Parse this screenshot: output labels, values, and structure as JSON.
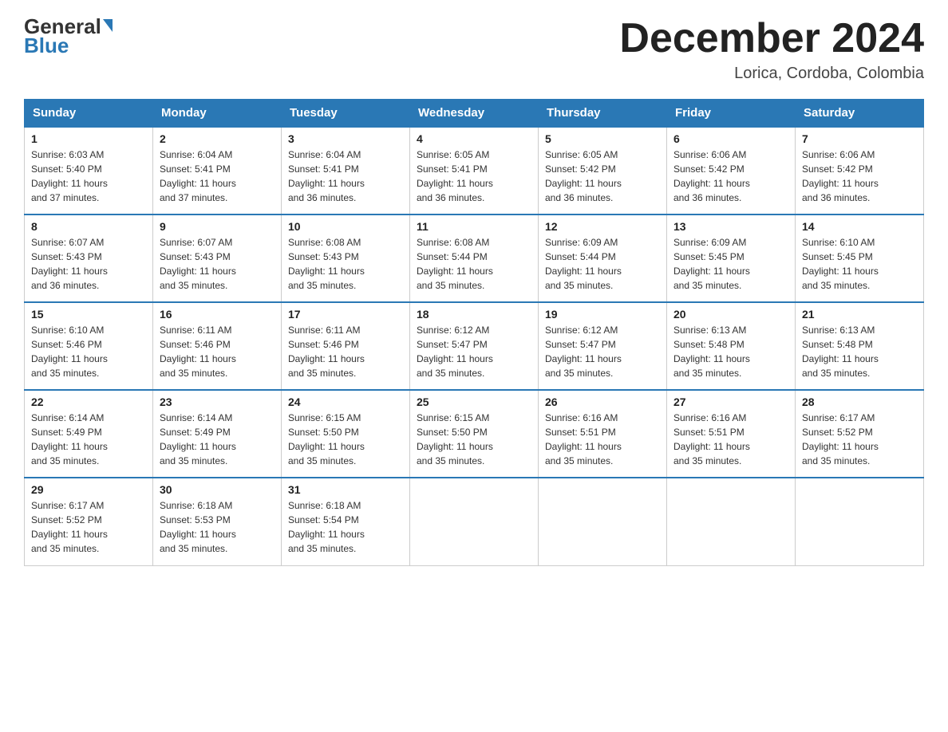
{
  "header": {
    "logo_general": "General",
    "logo_blue": "Blue",
    "title": "December 2024",
    "subtitle": "Lorica, Cordoba, Colombia"
  },
  "days_of_week": [
    "Sunday",
    "Monday",
    "Tuesday",
    "Wednesday",
    "Thursday",
    "Friday",
    "Saturday"
  ],
  "weeks": [
    [
      {
        "day": "1",
        "sunrise": "6:03 AM",
        "sunset": "5:40 PM",
        "daylight": "11 hours and 37 minutes."
      },
      {
        "day": "2",
        "sunrise": "6:04 AM",
        "sunset": "5:41 PM",
        "daylight": "11 hours and 37 minutes."
      },
      {
        "day": "3",
        "sunrise": "6:04 AM",
        "sunset": "5:41 PM",
        "daylight": "11 hours and 36 minutes."
      },
      {
        "day": "4",
        "sunrise": "6:05 AM",
        "sunset": "5:41 PM",
        "daylight": "11 hours and 36 minutes."
      },
      {
        "day": "5",
        "sunrise": "6:05 AM",
        "sunset": "5:42 PM",
        "daylight": "11 hours and 36 minutes."
      },
      {
        "day": "6",
        "sunrise": "6:06 AM",
        "sunset": "5:42 PM",
        "daylight": "11 hours and 36 minutes."
      },
      {
        "day": "7",
        "sunrise": "6:06 AM",
        "sunset": "5:42 PM",
        "daylight": "11 hours and 36 minutes."
      }
    ],
    [
      {
        "day": "8",
        "sunrise": "6:07 AM",
        "sunset": "5:43 PM",
        "daylight": "11 hours and 36 minutes."
      },
      {
        "day": "9",
        "sunrise": "6:07 AM",
        "sunset": "5:43 PM",
        "daylight": "11 hours and 35 minutes."
      },
      {
        "day": "10",
        "sunrise": "6:08 AM",
        "sunset": "5:43 PM",
        "daylight": "11 hours and 35 minutes."
      },
      {
        "day": "11",
        "sunrise": "6:08 AM",
        "sunset": "5:44 PM",
        "daylight": "11 hours and 35 minutes."
      },
      {
        "day": "12",
        "sunrise": "6:09 AM",
        "sunset": "5:44 PM",
        "daylight": "11 hours and 35 minutes."
      },
      {
        "day": "13",
        "sunrise": "6:09 AM",
        "sunset": "5:45 PM",
        "daylight": "11 hours and 35 minutes."
      },
      {
        "day": "14",
        "sunrise": "6:10 AM",
        "sunset": "5:45 PM",
        "daylight": "11 hours and 35 minutes."
      }
    ],
    [
      {
        "day": "15",
        "sunrise": "6:10 AM",
        "sunset": "5:46 PM",
        "daylight": "11 hours and 35 minutes."
      },
      {
        "day": "16",
        "sunrise": "6:11 AM",
        "sunset": "5:46 PM",
        "daylight": "11 hours and 35 minutes."
      },
      {
        "day": "17",
        "sunrise": "6:11 AM",
        "sunset": "5:46 PM",
        "daylight": "11 hours and 35 minutes."
      },
      {
        "day": "18",
        "sunrise": "6:12 AM",
        "sunset": "5:47 PM",
        "daylight": "11 hours and 35 minutes."
      },
      {
        "day": "19",
        "sunrise": "6:12 AM",
        "sunset": "5:47 PM",
        "daylight": "11 hours and 35 minutes."
      },
      {
        "day": "20",
        "sunrise": "6:13 AM",
        "sunset": "5:48 PM",
        "daylight": "11 hours and 35 minutes."
      },
      {
        "day": "21",
        "sunrise": "6:13 AM",
        "sunset": "5:48 PM",
        "daylight": "11 hours and 35 minutes."
      }
    ],
    [
      {
        "day": "22",
        "sunrise": "6:14 AM",
        "sunset": "5:49 PM",
        "daylight": "11 hours and 35 minutes."
      },
      {
        "day": "23",
        "sunrise": "6:14 AM",
        "sunset": "5:49 PM",
        "daylight": "11 hours and 35 minutes."
      },
      {
        "day": "24",
        "sunrise": "6:15 AM",
        "sunset": "5:50 PM",
        "daylight": "11 hours and 35 minutes."
      },
      {
        "day": "25",
        "sunrise": "6:15 AM",
        "sunset": "5:50 PM",
        "daylight": "11 hours and 35 minutes."
      },
      {
        "day": "26",
        "sunrise": "6:16 AM",
        "sunset": "5:51 PM",
        "daylight": "11 hours and 35 minutes."
      },
      {
        "day": "27",
        "sunrise": "6:16 AM",
        "sunset": "5:51 PM",
        "daylight": "11 hours and 35 minutes."
      },
      {
        "day": "28",
        "sunrise": "6:17 AM",
        "sunset": "5:52 PM",
        "daylight": "11 hours and 35 minutes."
      }
    ],
    [
      {
        "day": "29",
        "sunrise": "6:17 AM",
        "sunset": "5:52 PM",
        "daylight": "11 hours and 35 minutes."
      },
      {
        "day": "30",
        "sunrise": "6:18 AM",
        "sunset": "5:53 PM",
        "daylight": "11 hours and 35 minutes."
      },
      {
        "day": "31",
        "sunrise": "6:18 AM",
        "sunset": "5:54 PM",
        "daylight": "11 hours and 35 minutes."
      },
      null,
      null,
      null,
      null
    ]
  ],
  "labels": {
    "sunrise": "Sunrise:",
    "sunset": "Sunset:",
    "daylight": "Daylight:"
  }
}
